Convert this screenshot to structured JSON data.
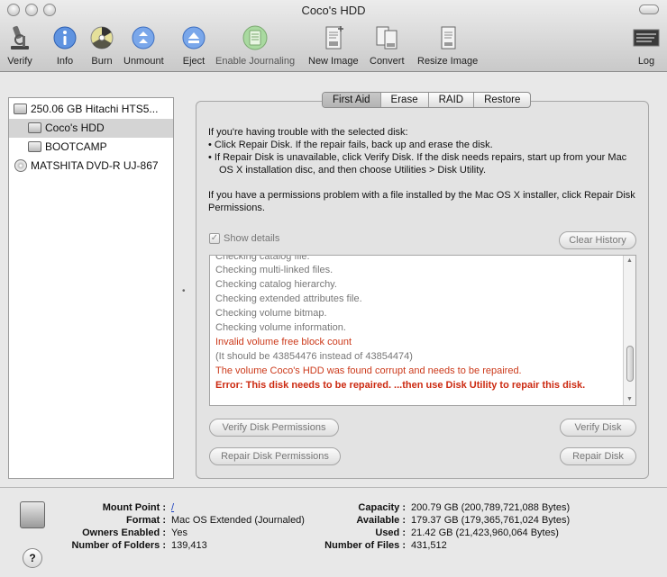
{
  "window": {
    "title": "Coco's HDD"
  },
  "toolbar": {
    "items": [
      {
        "label": "Verify",
        "icon": "microscope-icon"
      },
      {
        "label": "Info",
        "icon": "info-icon"
      },
      {
        "label": "Burn",
        "icon": "burn-icon"
      },
      {
        "label": "Unmount",
        "icon": "unmount-icon"
      },
      {
        "label": "Eject",
        "icon": "eject-icon"
      },
      {
        "label": "Enable Journaling",
        "icon": "journal-icon"
      },
      {
        "label": "New Image",
        "icon": "new-image-icon"
      },
      {
        "label": "Convert",
        "icon": "convert-icon"
      },
      {
        "label": "Resize Image",
        "icon": "resize-image-icon"
      },
      {
        "label": "Log",
        "icon": "log-icon"
      }
    ]
  },
  "sidebar": {
    "items": [
      {
        "label": "250.06 GB Hitachi HTS5...",
        "kind": "disk"
      },
      {
        "label": "Coco's HDD",
        "kind": "volume",
        "selected": true
      },
      {
        "label": "BOOTCAMP",
        "kind": "volume"
      },
      {
        "label": "MATSHITA DVD-R UJ-867",
        "kind": "optical"
      }
    ]
  },
  "tabs": [
    {
      "label": "First Aid",
      "active": true
    },
    {
      "label": "Erase"
    },
    {
      "label": "RAID"
    },
    {
      "label": "Restore"
    }
  ],
  "first_aid": {
    "intro": "If you're having trouble with the selected disk:",
    "bullet1": "• Click Repair Disk. If the repair fails, back up and erase the disk.",
    "bullet2": "• If Repair Disk is unavailable, click Verify Disk. If the disk needs repairs, start up from your Mac OS X installation disc, and then choose Utilities > Disk Utility.",
    "permissions_note": "If you have a permissions problem with a file installed by the Mac OS X installer, click Repair Disk Permissions.",
    "show_details_label": "Show details",
    "clear_history_label": "Clear History",
    "log_lines": [
      {
        "text": "Checking catalog file.",
        "style": "normal"
      },
      {
        "text": "Checking multi-linked files.",
        "style": "normal"
      },
      {
        "text": "Checking catalog hierarchy.",
        "style": "normal"
      },
      {
        "text": "Checking extended attributes file.",
        "style": "normal"
      },
      {
        "text": "Checking volume bitmap.",
        "style": "normal"
      },
      {
        "text": "Checking volume information.",
        "style": "normal"
      },
      {
        "text": "Invalid volume free block count",
        "style": "red"
      },
      {
        "text": "(It should be 43854476 instead of 43854474)",
        "style": "normal"
      },
      {
        "text": "The volume Coco's HDD was found corrupt and needs to be repaired.",
        "style": "red"
      },
      {
        "text": "Error: This disk needs to be repaired. ...then use Disk Utility to repair this disk.",
        "style": "bold"
      }
    ],
    "verify_permissions_label": "Verify Disk Permissions",
    "verify_disk_label": "Verify Disk",
    "repair_permissions_label": "Repair Disk Permissions",
    "repair_disk_label": "Repair Disk"
  },
  "info": {
    "left": [
      {
        "label": "Mount Point :",
        "value": "/",
        "link": true
      },
      {
        "label": "Format :",
        "value": "Mac OS Extended (Journaled)"
      },
      {
        "label": "Owners Enabled :",
        "value": "Yes"
      },
      {
        "label": "Number of Folders :",
        "value": "139,413"
      }
    ],
    "right": [
      {
        "label": "Capacity :",
        "value": "200.79 GB (200,789,721,088 Bytes)"
      },
      {
        "label": "Available :",
        "value": "179.37 GB (179,365,761,024 Bytes)"
      },
      {
        "label": "Used :",
        "value": "21.42 GB (21,423,960,064 Bytes)"
      },
      {
        "label": "Number of Files :",
        "value": "431,512"
      }
    ]
  },
  "colors": {
    "error_red": "#cc3a1b",
    "link_blue": "#1a3fbf",
    "info_blue": "#3a78d8"
  }
}
